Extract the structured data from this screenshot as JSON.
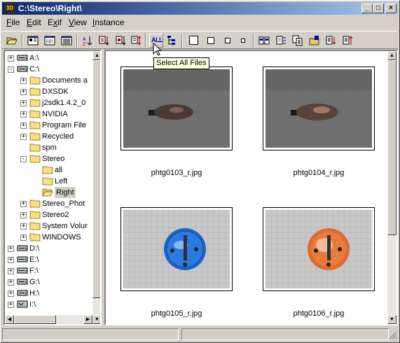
{
  "window": {
    "title": "C:\\Stereo\\Right\\",
    "app_icon": "3D"
  },
  "menu": [
    {
      "label": "File",
      "key": "F",
      "rest": "ile"
    },
    {
      "label": "Edit",
      "key": "E",
      "rest": "dit"
    },
    {
      "label": "Exif",
      "key": "x",
      "pre": "E",
      "rest": "if"
    },
    {
      "label": "View",
      "key": "V",
      "rest": "iew"
    },
    {
      "label": "Instance",
      "key": "I",
      "rest": "nstance"
    }
  ],
  "toolbar": {
    "select_all_label": "ALL",
    "tooltip": "Select All Files"
  },
  "tree": {
    "items": [
      {
        "label": "A:\\",
        "type": "drive",
        "expander": "+"
      },
      {
        "label": "C:\\",
        "type": "drive",
        "expander": "-"
      },
      {
        "label": "Documents a",
        "type": "folder",
        "expander": "+"
      },
      {
        "label": "DXSDK",
        "type": "folder",
        "expander": "+"
      },
      {
        "label": "j2sdk1.4.2_0",
        "type": "folder",
        "expander": "+"
      },
      {
        "label": "NVIDIA",
        "type": "folder",
        "expander": "+"
      },
      {
        "label": "Program File",
        "type": "folder",
        "expander": "+"
      },
      {
        "label": "Recycled",
        "type": "folder",
        "expander": "+"
      },
      {
        "label": "spm",
        "type": "folder",
        "expander": ""
      },
      {
        "label": "Stereo",
        "type": "folder",
        "expander": "-"
      },
      {
        "label": "all",
        "type": "folder",
        "expander": ""
      },
      {
        "label": "Left",
        "type": "folder",
        "expander": ""
      },
      {
        "label": "Right",
        "type": "open-folder",
        "expander": "",
        "selected": true
      },
      {
        "label": "Stereo_Phot",
        "type": "folder",
        "expander": "+"
      },
      {
        "label": "Stereo2",
        "type": "folder",
        "expander": "+"
      },
      {
        "label": "System Volur",
        "type": "folder",
        "expander": "+"
      },
      {
        "label": "WINDOWS",
        "type": "folder",
        "expander": "+"
      },
      {
        "label": "D:\\",
        "type": "drive",
        "expander": "+"
      },
      {
        "label": "E:\\",
        "type": "drive",
        "expander": "+"
      },
      {
        "label": "F:\\",
        "type": "drive",
        "expander": "+"
      },
      {
        "label": "G:\\",
        "type": "drive",
        "expander": "+"
      },
      {
        "label": "H:\\",
        "type": "drive",
        "expander": "+"
      },
      {
        "label": "I:\\",
        "type": "cd-drive",
        "expander": "+"
      }
    ]
  },
  "files": [
    {
      "name": "phtg0103_r.jpg",
      "subject": "balloon"
    },
    {
      "name": "phtg0104_r.jpg",
      "subject": "balloon"
    },
    {
      "name": "phtg0105_r.jpg",
      "subject": "blue-dish"
    },
    {
      "name": "phtg0106_r.jpg",
      "subject": "orange-dish"
    }
  ],
  "colors": {
    "titlebar_start": "#0a246a",
    "titlebar_end": "#a6caf0",
    "tooltip_bg": "#ffffe1"
  }
}
